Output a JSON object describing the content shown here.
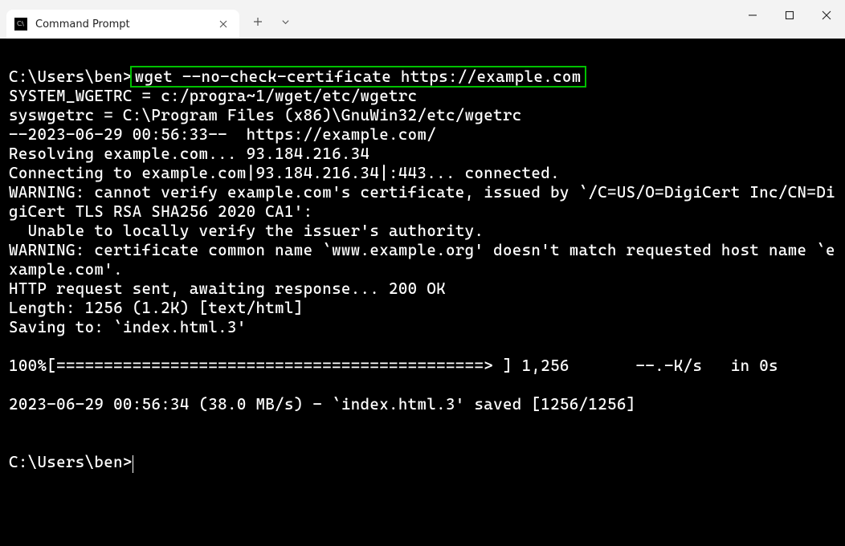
{
  "tab": {
    "title": "Command Prompt"
  },
  "terminal": {
    "prompt1": "C:\\Users\\ben>",
    "highlighted_command": "wget --no-check-certificate https://example.com",
    "body": "SYSTEM_WGETRC = c:/progra~1/wget/etc/wgetrc\nsyswgetrc = C:\\Program Files (x86)\\GnuWin32/etc/wgetrc\n--2023-06-29 00:56:33--  https://example.com/\nResolving example.com... 93.184.216.34\nConnecting to example.com|93.184.216.34|:443... connected.\nWARNING: cannot verify example.com's certificate, issued by `/C=US/O=DigiCert Inc/CN=DigiCert TLS RSA SHA256 2020 CA1':\n  Unable to locally verify the issuer's authority.\nWARNING: certificate common name `www.example.org' doesn't match requested host name `example.com'.\nHTTP request sent, awaiting response... 200 OK\nLength: 1256 (1.2K) [text/html]\nSaving to: `index.html.3'\n\n100%[=============================================> ] 1,256       --.-K/s   in 0s\n\n2023-06-29 00:56:34 (38.0 MB/s) - `index.html.3' saved [1256/1256]\n\n",
    "prompt2": "C:\\Users\\ben>"
  }
}
